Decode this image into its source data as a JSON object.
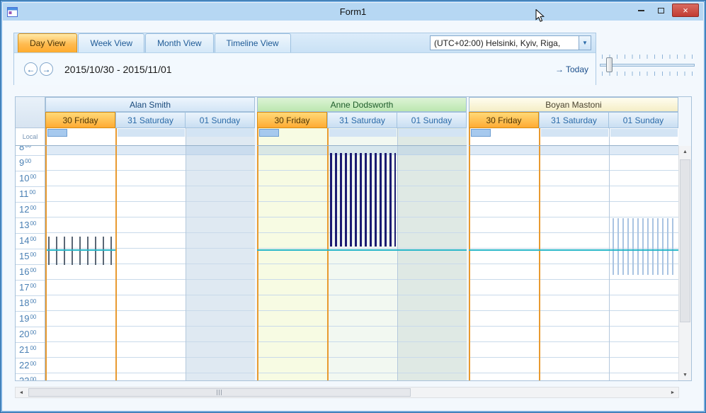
{
  "window": {
    "title": "Form1"
  },
  "icons": {
    "prev": "←",
    "next": "→",
    "dropdown": "▼",
    "today_arrow": "→",
    "scroll_up": "▲",
    "scroll_down": "▼",
    "scroll_left": "◄",
    "scroll_right": "►",
    "close": "×"
  },
  "toolbar": {
    "tabs": [
      {
        "label": "Day View",
        "active": true
      },
      {
        "label": "Week View",
        "active": false
      },
      {
        "label": "Month View",
        "active": false
      },
      {
        "label": "Timeline View",
        "active": false
      }
    ],
    "timezone_value": "(UTC+02:00) Helsinki, Kyiv, Riga,"
  },
  "navigation": {
    "date_range": "2015/10/30 - 2015/11/01",
    "today_label": "Today"
  },
  "scheduler": {
    "ruler_caption": "Local",
    "minute_suffix": "00",
    "hours": [
      "8",
      "9",
      "10",
      "11",
      "12",
      "13",
      "14",
      "15",
      "16",
      "17",
      "18",
      "19",
      "20",
      "21",
      "22",
      "23"
    ],
    "day_labels": [
      "30 Friday",
      "31 Saturday",
      "01 Sunday"
    ],
    "resources": [
      {
        "name": "Alan Smith"
      },
      {
        "name": "Anne Dodsworth"
      },
      {
        "name": "Boyan Mastoni"
      }
    ],
    "colors": {
      "today_header": "#ffb946",
      "current_time_line": "#29b7c9",
      "alan_region_stripe": "#5b6775",
      "anne_region_stripe": "#1c1c72",
      "boyan_region_stripe": "#aac4e2"
    }
  }
}
